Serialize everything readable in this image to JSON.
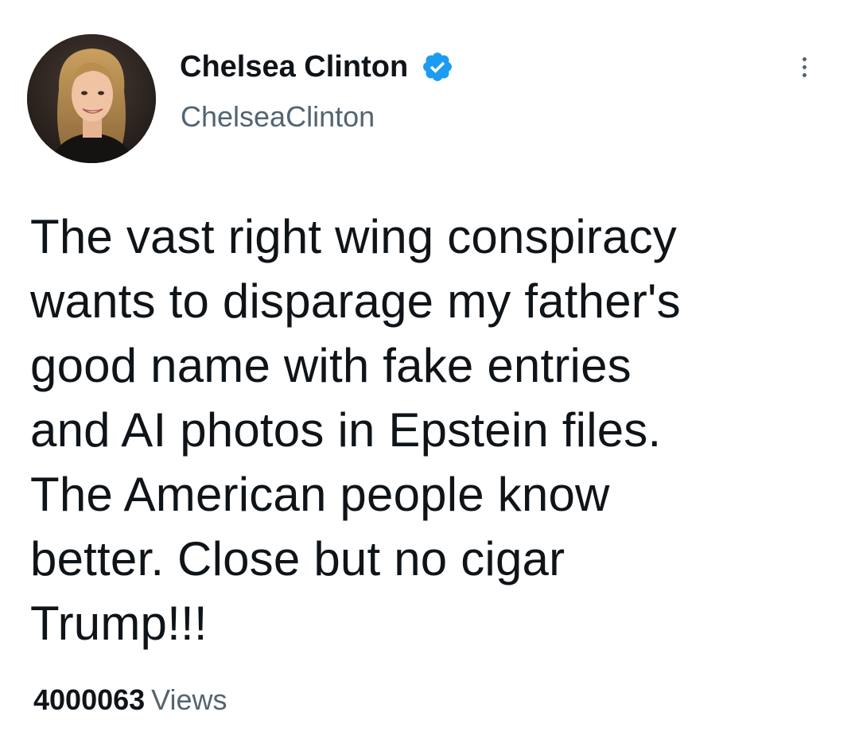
{
  "author": {
    "display_name": "Chelsea Clinton",
    "handle": "ChelseaClinton",
    "verified": true,
    "avatar_icon": "profile-photo",
    "verified_icon": "verified-badge-icon"
  },
  "tweet": {
    "text": "The vast right wing conspiracy\nwants to disparage my father's\ngood name with fake entries\nand AI photos in Epstein files.\nThe American people know\nbetter. Close but no cigar\nTrump!!!"
  },
  "stats": {
    "views_count": "4000063",
    "views_label": "Views"
  },
  "menu": {
    "icon": "more-vertical-icon"
  },
  "colors": {
    "background": "#ffffff",
    "text_primary": "#0f1419",
    "text_secondary": "#536471",
    "verified_blue": "#1d9bf0"
  }
}
